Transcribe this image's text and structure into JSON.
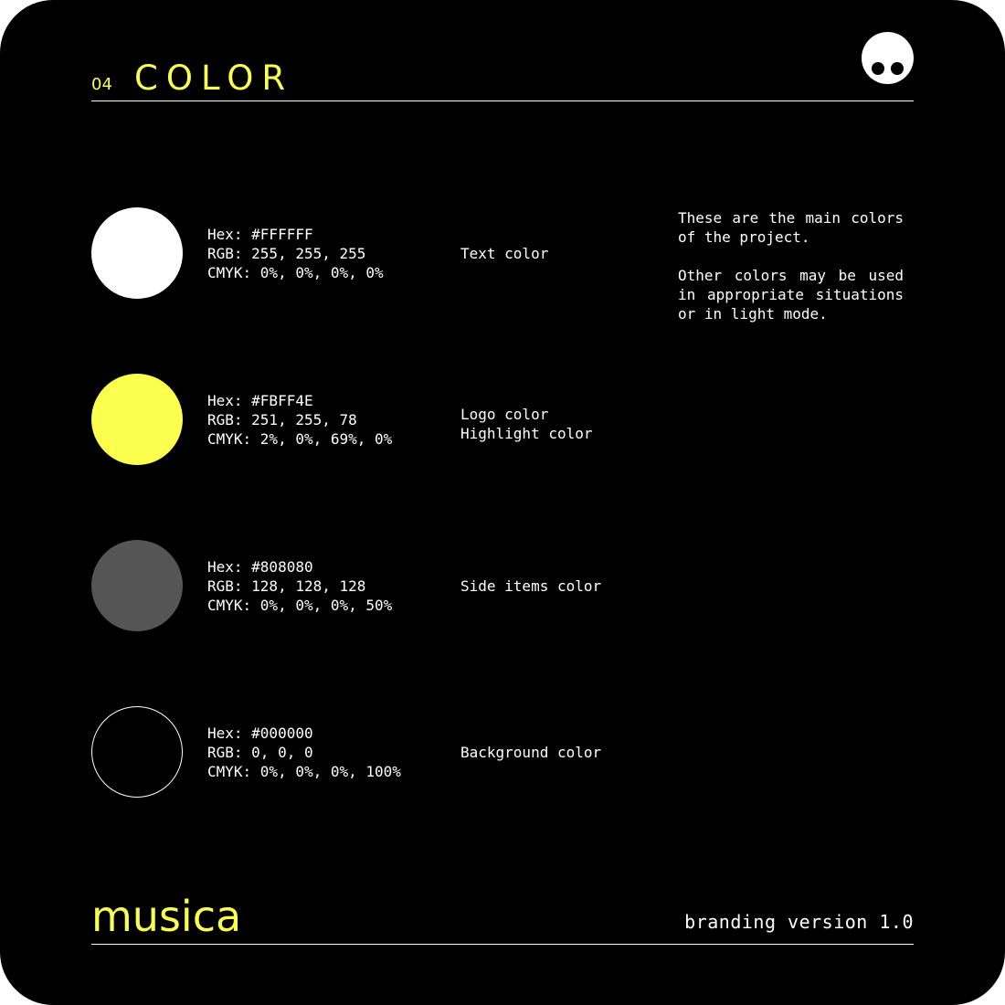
{
  "header": {
    "section_number": "04",
    "section_title": "COLOR"
  },
  "colors": [
    {
      "hex": "Hex: #FFFFFF",
      "rgb": "RGB: 255, 255, 255",
      "cmyk": "CMYK: 0%, 0%, 0%, 0%",
      "usage": [
        "Text color"
      ],
      "swatch_color": "#FFFFFF"
    },
    {
      "hex": "Hex: #FBFF4E",
      "rgb": "RGB: 251, 255, 78",
      "cmyk": "CMYK: 2%, 0%, 69%, 0%",
      "usage": [
        "Logo color",
        "Highlight color"
      ],
      "swatch_color": "#FBFF4E"
    },
    {
      "hex": "Hex: #808080",
      "rgb": "RGB: 128, 128, 128",
      "cmyk": "CMYK: 0%, 0%, 0%, 50%",
      "usage": [
        "Side items color"
      ],
      "swatch_color": "#555555"
    },
    {
      "hex": "Hex: #000000",
      "rgb": "RGB: 0, 0, 0",
      "cmyk": "CMYK: 0%, 0%, 0%, 100%",
      "usage": [
        "Background color"
      ],
      "swatch_color": "#000000"
    }
  ],
  "intro": {
    "paragraph_1": "These are the main colors of the project.",
    "paragraph_2": "Other colors may be used in appropriate situations or in light mode."
  },
  "footer": {
    "brand_name": "musica",
    "version": "branding version 1.0"
  },
  "theme": {
    "accent": "#FBFF4E",
    "background": "#000000",
    "text": "#FFFFFF"
  },
  "icons": {
    "logo": "face-logo-icon"
  }
}
